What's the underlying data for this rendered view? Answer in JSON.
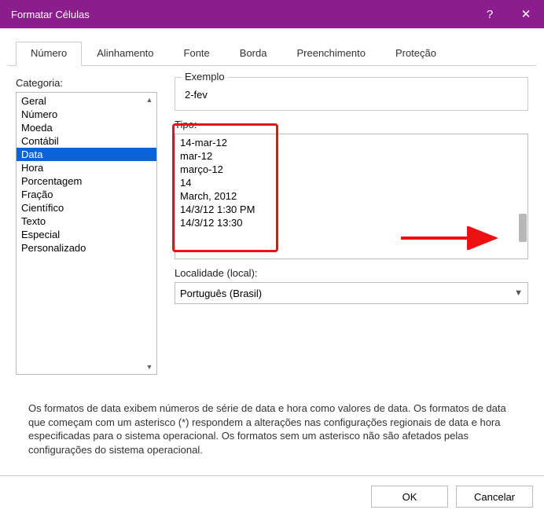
{
  "titlebar": {
    "title": "Formatar Células",
    "help": "?",
    "close": "✕"
  },
  "tabs": [
    {
      "label": "Número",
      "active": true
    },
    {
      "label": "Alinhamento"
    },
    {
      "label": "Fonte"
    },
    {
      "label": "Borda"
    },
    {
      "label": "Preenchimento"
    },
    {
      "label": "Proteção"
    }
  ],
  "category": {
    "label": "Categoria:",
    "items": [
      "Geral",
      "Número",
      "Moeda",
      "Contábil",
      "Data",
      "Hora",
      "Porcentagem",
      "Fração",
      "Científico",
      "Texto",
      "Especial",
      "Personalizado"
    ],
    "selected": "Data"
  },
  "example": {
    "legend": "Exemplo",
    "value": "2-fev"
  },
  "type": {
    "label": "Tipo:",
    "items": [
      "14-mar-12",
      "mar-12",
      "março-12",
      "14",
      "March, 2012",
      "14/3/12 1:30 PM",
      "14/3/12 13:30"
    ]
  },
  "locale": {
    "label": "Localidade (local):",
    "value": "Português (Brasil)"
  },
  "description": "Os formatos de data exibem números de série de data e hora como valores de data. Os formatos de data que começam com um asterisco (*) respondem a alterações nas configurações regionais de data e hora especificadas para o sistema operacional. Os formatos sem um asterisco não são afetados pelas configurações do sistema operacional.",
  "footer": {
    "ok": "OK",
    "cancel": "Cancelar"
  }
}
